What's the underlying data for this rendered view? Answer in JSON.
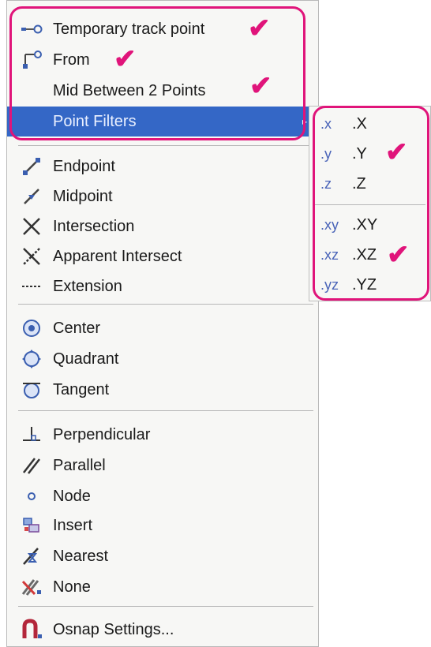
{
  "menu": {
    "items": [
      {
        "label": "Temporary track point",
        "icon": "track-point-icon"
      },
      {
        "label": "From",
        "icon": "from-icon"
      },
      {
        "label": "Mid Between 2 Points",
        "icon": ""
      },
      {
        "label": "Point Filters",
        "icon": "",
        "submenu_arrow": "▸"
      },
      {
        "label": "Endpoint",
        "icon": "endpoint-icon"
      },
      {
        "label": "Midpoint",
        "icon": "midpoint-icon"
      },
      {
        "label": "Intersection",
        "icon": "intersection-icon"
      },
      {
        "label": "Apparent Intersect",
        "icon": "apparent-intersect-icon"
      },
      {
        "label": "Extension",
        "icon": "extension-icon"
      },
      {
        "label": "Center",
        "icon": "center-icon"
      },
      {
        "label": "Quadrant",
        "icon": "quadrant-icon"
      },
      {
        "label": "Tangent",
        "icon": "tangent-icon"
      },
      {
        "label": "Perpendicular",
        "icon": "perpendicular-icon"
      },
      {
        "label": "Parallel",
        "icon": "parallel-icon"
      },
      {
        "label": "Node",
        "icon": "node-icon"
      },
      {
        "label": "Insert",
        "icon": "insert-icon"
      },
      {
        "label": "Nearest",
        "icon": "nearest-icon"
      },
      {
        "label": "None",
        "icon": "none-icon"
      },
      {
        "label": "Osnap Settings...",
        "icon": "osnap-settings-icon"
      }
    ]
  },
  "submenu": {
    "items": [
      {
        "icon_text": ".x",
        "label": ".X"
      },
      {
        "icon_text": ".y",
        "label": ".Y"
      },
      {
        "icon_text": ".z",
        "label": ".Z"
      },
      {
        "icon_text": ".xy",
        "label": ".XY"
      },
      {
        "icon_text": ".xz",
        "label": ".XZ"
      },
      {
        "icon_text": ".yz",
        "label": ".YZ"
      }
    ]
  },
  "annotations": {
    "check_glyph": "✔",
    "highlight_color": "#e0147a"
  },
  "colors": {
    "selected_bg": "#3467c6",
    "menu_bg": "#f7f7f5"
  }
}
